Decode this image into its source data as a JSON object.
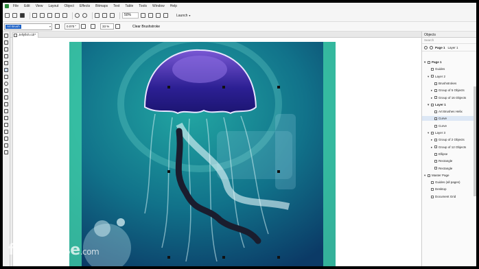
{
  "menubar": {
    "items": [
      "File",
      "Edit",
      "View",
      "Layout",
      "Object",
      "Effects",
      "Bitmaps",
      "Text",
      "Table",
      "Tools",
      "Window",
      "Help"
    ]
  },
  "toolbar": {
    "zoom": "50%",
    "launch_label": "Launch"
  },
  "propbar": {
    "brush_selected": "Art Brush",
    "size_value": "0.070 \"",
    "smoothing_value": "33 %",
    "clear_label": "Clear Brushstroke"
  },
  "document": {
    "tab_label": "Jellyfish.cdr*"
  },
  "watermark": {
    "text": "filehorse",
    "suffix": ".com"
  },
  "docker": {
    "title": "Objects",
    "search_placeholder": "Search",
    "page_label": "Page 1",
    "layer_label": "Layer 1",
    "tree": [
      {
        "label": "Page 1",
        "level": 0,
        "arrow": "▾",
        "bold": true
      },
      {
        "label": "Guides",
        "level": 1,
        "arrow": "",
        "bold": false
      },
      {
        "label": "Layer 2",
        "level": 1,
        "arrow": "▾",
        "bold": false
      },
      {
        "label": "Brushstrokes",
        "level": 2,
        "arrow": "",
        "bold": false
      },
      {
        "label": "Group of 5 Objects",
        "level": 2,
        "arrow": "▸",
        "bold": false
      },
      {
        "label": "Group of 16 Objects",
        "level": 2,
        "arrow": "▸",
        "bold": false
      },
      {
        "label": "Layer 1",
        "level": 1,
        "arrow": "▾",
        "bold": true
      },
      {
        "label": "Art Brushes Helix",
        "level": 2,
        "arrow": "",
        "bold": false
      },
      {
        "label": "Curve",
        "level": 2,
        "arrow": "",
        "bold": false,
        "highlight": true
      },
      {
        "label": "Curve",
        "level": 2,
        "arrow": "",
        "bold": false
      },
      {
        "label": "Layer 3",
        "level": 1,
        "arrow": "▾",
        "bold": false
      },
      {
        "label": "Group of 2 Objects",
        "level": 2,
        "arrow": "▸",
        "bold": false
      },
      {
        "label": "Group of 12 Objects",
        "level": 2,
        "arrow": "▸",
        "bold": false
      },
      {
        "label": "Ellipse",
        "level": 2,
        "arrow": "",
        "bold": false
      },
      {
        "label": "Rectangle",
        "level": 2,
        "arrow": "",
        "bold": false
      },
      {
        "label": "Rectangle",
        "level": 2,
        "arrow": "",
        "bold": false
      },
      {
        "label": "Master Page",
        "level": 0,
        "arrow": "▾",
        "bold": false
      },
      {
        "label": "Guides (all pages)",
        "level": 1,
        "arrow": "",
        "bold": false
      },
      {
        "label": "Desktop",
        "level": 1,
        "arrow": "",
        "bold": false
      },
      {
        "label": "Document Grid",
        "level": 1,
        "arrow": "",
        "bold": false
      }
    ]
  },
  "colors": {
    "accent": "#1a5fc4",
    "page_teal": "#1f9c9a",
    "page_deep": "#0c3c6a",
    "jelly_bell": "#2a1f8c",
    "jelly_bell_light": "#6d4cc9",
    "side_strip": "#3fd0a8"
  }
}
